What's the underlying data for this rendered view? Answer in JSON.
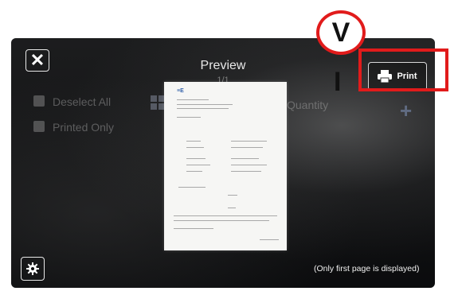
{
  "preview": {
    "title": "Preview",
    "page_indicator": "1/1"
  },
  "background": {
    "deselect_all": "Deselect All",
    "printed_label": "Printed Only",
    "quantity_label": "Quantity"
  },
  "print_button": {
    "label": "Print"
  },
  "footnote": "(Only first page is displayed)",
  "document": {
    "logo": "≡E"
  },
  "annotation": {
    "letter": "V",
    "numeral": "I"
  },
  "colors": {
    "annotation_red": "#e11b1b",
    "screen_bg": "#0b0c0e",
    "logo_blue": "#2f5ea8"
  },
  "icons": {
    "close": "close-icon",
    "print": "printer-icon",
    "settings": "gear-icon"
  }
}
